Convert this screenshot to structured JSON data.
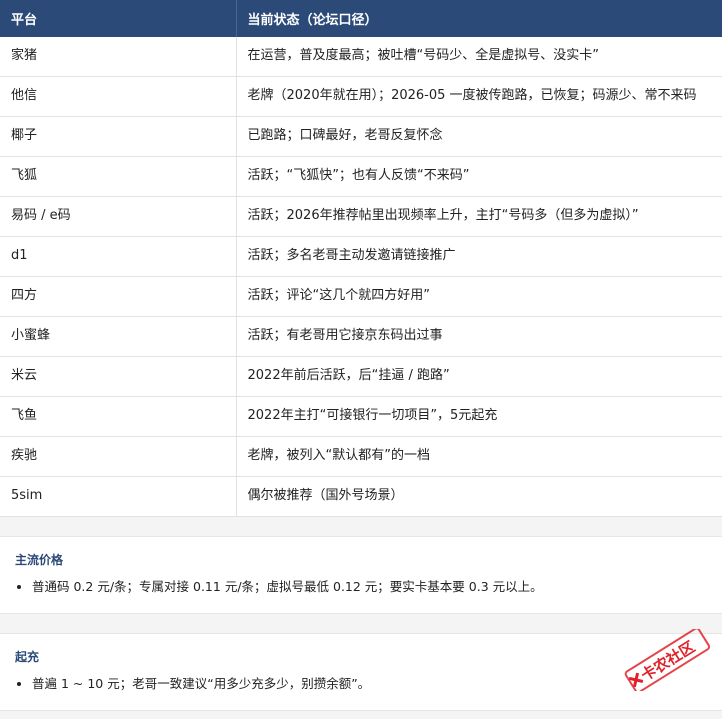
{
  "table": {
    "headers": [
      "平台",
      "当前状态（论坛口径）"
    ],
    "rows": [
      [
        "家猪",
        "在运营，普及度最高；被吐槽“号码少、全是虚拟号、没实卡”"
      ],
      [
        "他信",
        "老牌（2020年就在用）；2026-05 一度被传跑路，已恢复；码源少、常不来码"
      ],
      [
        "椰子",
        "已跑路；口碑最好，老哥反复怀念"
      ],
      [
        "飞狐",
        "活跃；“飞狐快”；也有人反馈“不来码”"
      ],
      [
        "易码 / e码",
        "活跃；2026年推荐帖里出现频率上升，主打“号码多（但多为虚拟）”"
      ],
      [
        "d1",
        "活跃；多名老哥主动发邀请链接推广"
      ],
      [
        "四方",
        "活跃；评论“这几个就四方好用”"
      ],
      [
        "小蜜蜂",
        "活跃；有老哥用它接京东码出过事"
      ],
      [
        "米云",
        "2022年前后活跃，后“挂逼 / 跑路”"
      ],
      [
        "飞鱼",
        "2022年主打“可接银行一切项目”，5元起充"
      ],
      [
        "疾驰",
        "老牌，被列入“默认都有”的一档"
      ],
      [
        "5sim",
        "偶尔被推荐（国外号场景）"
      ]
    ]
  },
  "price_section": {
    "title": "主流价格",
    "items": [
      "普通码 0.2 元/条；专属对接 0.11 元/条；虚拟号最低 0.12 元；要实卡基本要 0.3 元以上。"
    ]
  },
  "recharge_section": {
    "title": "起充",
    "items": [
      "普遍 1 ~ 10 元；老哥一致建议“用多少充多少，别攒余额”。"
    ]
  },
  "watermark": {
    "text": "卡农社区",
    "color": "#e0232a"
  }
}
